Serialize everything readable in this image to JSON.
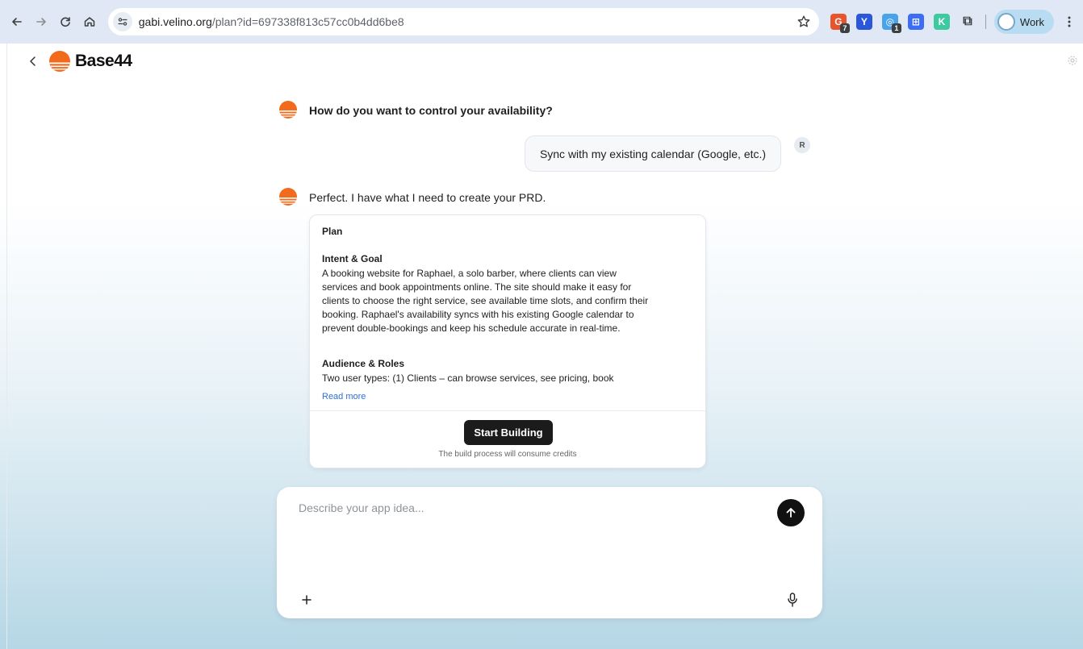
{
  "browser": {
    "url_host": "gabi.velino.org",
    "url_path": "/plan?id=697338f813c57cc0b4dd6be8",
    "extensions": [
      {
        "icon": "google-extension-icon",
        "color": "#e8542c",
        "badge": "7"
      },
      {
        "icon": "y-extension-icon",
        "color": "#2b58d9",
        "badge": ""
      },
      {
        "icon": "chrome-store-extension-icon",
        "color": "#4aa3e8",
        "badge": "1"
      },
      {
        "icon": "grid-extension-icon",
        "color": "#3b6ef5",
        "badge": ""
      },
      {
        "icon": "k-extension-icon",
        "color": "#3ec9a0",
        "badge": ""
      },
      {
        "icon": "puzzle-icon",
        "color": "#3c4043",
        "badge": ""
      }
    ],
    "profile_label": "Work"
  },
  "app": {
    "brand": "Base44",
    "accent": "#f26b1d"
  },
  "chat": {
    "q1": "How do you want to control your availability?",
    "user_reply": "Sync with my existing calendar (Google, etc.)",
    "user_initial": "R",
    "ai_reply": "Perfect. I have what I need to create your PRD."
  },
  "plan": {
    "title": "Plan",
    "intent_heading": "Intent & Goal",
    "intent_lines": [
      "A booking website for Raphael, a solo barber, where clients can view",
      "services and book appointments online. The site should make it easy for",
      "clients to choose the right service, see available time slots, and confirm their",
      "booking. Raphael's availability syncs with his existing Google calendar to",
      "prevent double-bookings and keep his schedule accurate in real-time."
    ],
    "audience_heading": "Audience & Roles",
    "audience_text": "Two user types: (1) Clients – can browse services, see pricing, book",
    "read_more": "Read more",
    "start_button": "Start Building",
    "credits_note": "The build process will consume credits"
  },
  "composer": {
    "placeholder": "Describe your app idea..."
  }
}
